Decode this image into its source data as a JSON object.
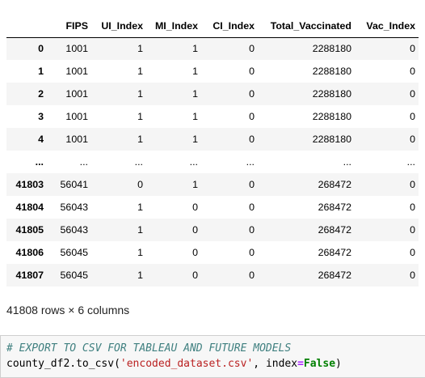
{
  "dataframe": {
    "columns": [
      "",
      "FIPS",
      "UI_Index",
      "MI_Index",
      "CI_Index",
      "Total_Vaccinated",
      "Vac_Index"
    ],
    "rows": [
      {
        "index": "0",
        "cells": [
          "1001",
          "1",
          "1",
          "0",
          "2288180",
          "0"
        ]
      },
      {
        "index": "1",
        "cells": [
          "1001",
          "1",
          "1",
          "0",
          "2288180",
          "0"
        ]
      },
      {
        "index": "2",
        "cells": [
          "1001",
          "1",
          "1",
          "0",
          "2288180",
          "0"
        ]
      },
      {
        "index": "3",
        "cells": [
          "1001",
          "1",
          "1",
          "0",
          "2288180",
          "0"
        ]
      },
      {
        "index": "4",
        "cells": [
          "1001",
          "1",
          "1",
          "0",
          "2288180",
          "0"
        ]
      },
      {
        "index": "...",
        "cells": [
          "...",
          "...",
          "...",
          "...",
          "...",
          "..."
        ]
      },
      {
        "index": "41803",
        "cells": [
          "56041",
          "0",
          "1",
          "0",
          "268472",
          "0"
        ]
      },
      {
        "index": "41804",
        "cells": [
          "56043",
          "1",
          "0",
          "0",
          "268472",
          "0"
        ]
      },
      {
        "index": "41805",
        "cells": [
          "56043",
          "1",
          "0",
          "0",
          "268472",
          "0"
        ]
      },
      {
        "index": "41806",
        "cells": [
          "56045",
          "1",
          "0",
          "0",
          "268472",
          "0"
        ]
      },
      {
        "index": "41807",
        "cells": [
          "56045",
          "1",
          "0",
          "0",
          "268472",
          "0"
        ]
      }
    ],
    "shape_text": "41808 rows × 6 columns"
  },
  "code_cell": {
    "comment": "# EXPORT TO CSV FOR TABLEAU AND FUTURE MODELS",
    "line2": {
      "obj": "county_df2",
      "method": ".to_csv(",
      "string": "'encoded_dataset.csv'",
      "sep": ", ",
      "kwarg": "index",
      "eq": "=",
      "value": "False",
      "close": ")"
    }
  },
  "colors": {
    "comment": "#408080",
    "string": "#ba2121",
    "keyword": "#008000",
    "operator": "#aa22ff",
    "code_bg": "#f7f7f7",
    "stripe": "#f5f5f5"
  }
}
